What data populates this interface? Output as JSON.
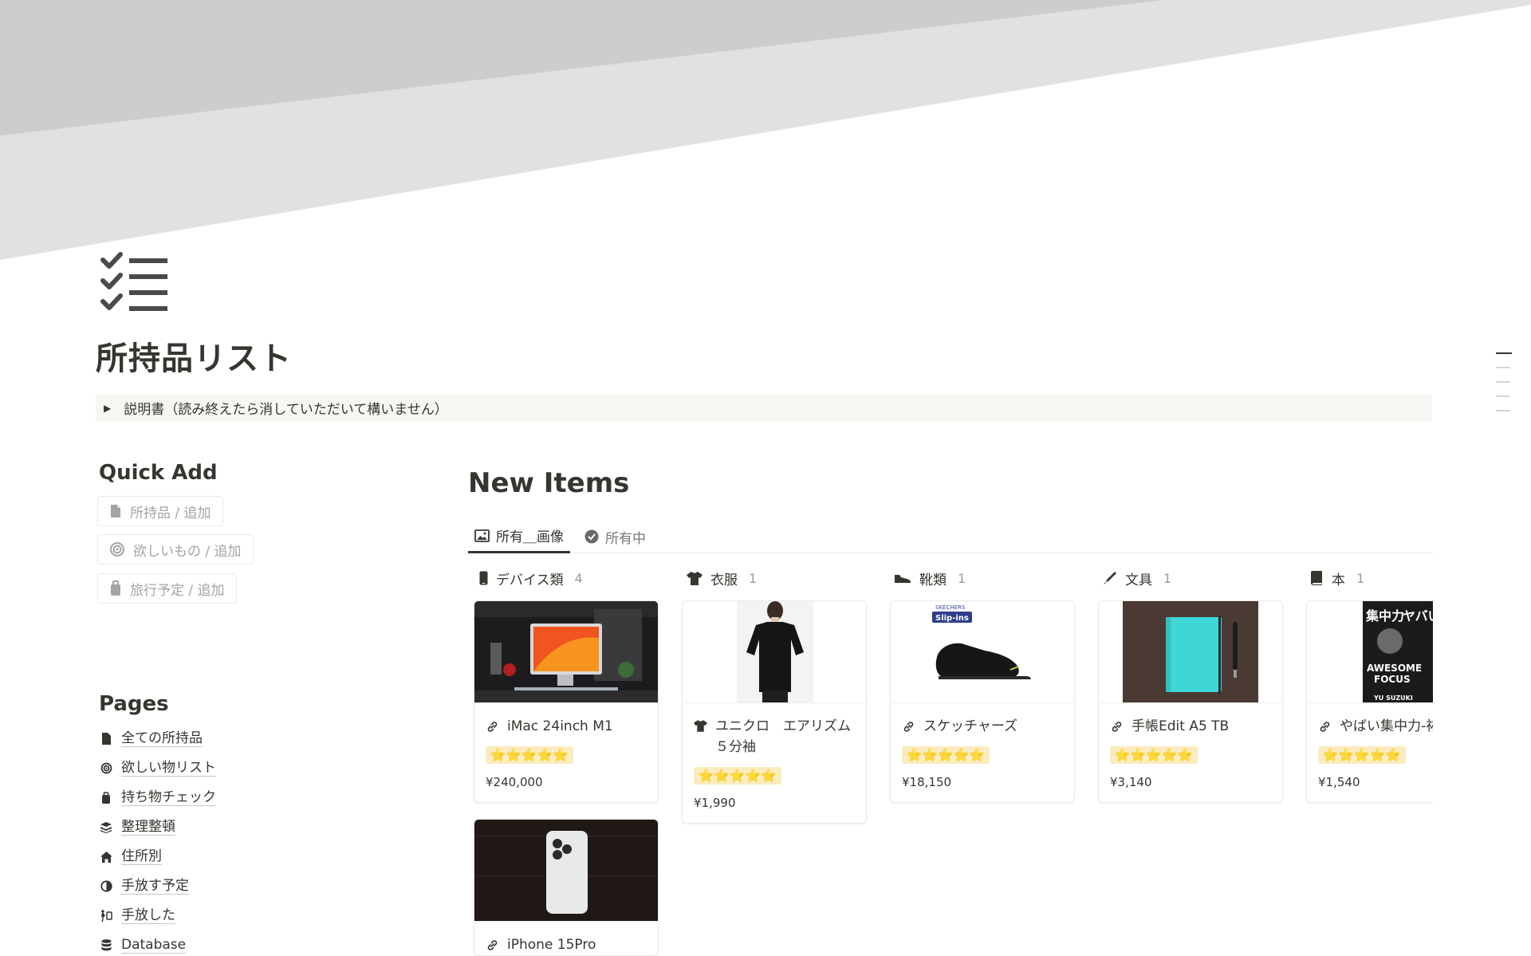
{
  "page": {
    "title": "所持品リスト",
    "icon": "checklist-icon",
    "toggle_text": "説明書（読み終えたら消していただいて構いません）"
  },
  "quick_add": {
    "heading": "Quick Add",
    "buttons": [
      {
        "label": "所持品 / 追加",
        "icon": "document-icon"
      },
      {
        "label": "欲しいもの / 追加",
        "icon": "target-icon"
      },
      {
        "label": "旅行予定 / 追加",
        "icon": "luggage-icon"
      }
    ]
  },
  "pages": {
    "heading": "Pages",
    "items": [
      {
        "label": "全ての所持品",
        "icon": "document-icon"
      },
      {
        "label": "欲しい物リスト",
        "icon": "target-icon"
      },
      {
        "label": "持ち物チェック",
        "icon": "luggage-icon"
      },
      {
        "label": "整理整頓",
        "icon": "layers-icon"
      },
      {
        "label": "住所別",
        "icon": "home-icon"
      },
      {
        "label": "手放す予定",
        "icon": "half-circle-icon"
      },
      {
        "label": "手放した",
        "icon": "person-walking-icon"
      },
      {
        "label": "Database",
        "icon": "database-icon"
      }
    ]
  },
  "database": {
    "title": "New Items",
    "tabs": [
      {
        "label": "所有＿画像",
        "icon": "image-icon",
        "active": true
      },
      {
        "label": "所有中",
        "icon": "check-circle-icon",
        "active": false
      }
    ],
    "columns": [
      {
        "name": "デバイス類",
        "count": "4",
        "icon": "phone-icon"
      },
      {
        "name": "衣服",
        "count": "1",
        "icon": "shirt-icon"
      },
      {
        "name": "靴類",
        "count": "1",
        "icon": "shoe-icon"
      },
      {
        "name": "文具",
        "count": "1",
        "icon": "pen-icon"
      },
      {
        "name": "本",
        "count": "1",
        "icon": "book-icon"
      }
    ],
    "cards": [
      {
        "name": "iMac 24inch M1",
        "rating": "⭐⭐⭐⭐⭐",
        "price": "¥240,000",
        "image": "imac-photo"
      },
      {
        "name": "ユニクロ　エアリズム５分袖",
        "rating": "⭐⭐⭐⭐⭐",
        "price": "¥1,990",
        "image": "tshirt-photo"
      },
      {
        "name": "スケッチャーズ",
        "rating": "⭐⭐⭐⭐⭐",
        "price": "¥18,150",
        "image": "shoe-photo",
        "image_text": [
          "SKECHERS",
          "Slip-ins"
        ]
      },
      {
        "name": "手帳Edit A5 TB",
        "rating": "⭐⭐⭐⭐⭐",
        "price": "¥3,140",
        "image": "notebook-photo"
      },
      {
        "name": "やばい集中力-祐",
        "rating": "⭐⭐⭐⭐⭐",
        "price": "¥1,540",
        "image": "book-cover-photo",
        "image_text": [
          "集中力",
          "ヤバい",
          "AWESOME",
          "FOCUS",
          "YU SUZUKI"
        ]
      },
      {
        "name": "iPhone 15Pro",
        "rating": "",
        "price": "",
        "image": "iphone-photo"
      }
    ]
  },
  "colors": {
    "text": "#37352f",
    "muted": "#a5a4a1",
    "cover_dark": "#cdcdcf",
    "cover_light": "#e1e1e1",
    "rating_bg": "#fbecbd"
  }
}
